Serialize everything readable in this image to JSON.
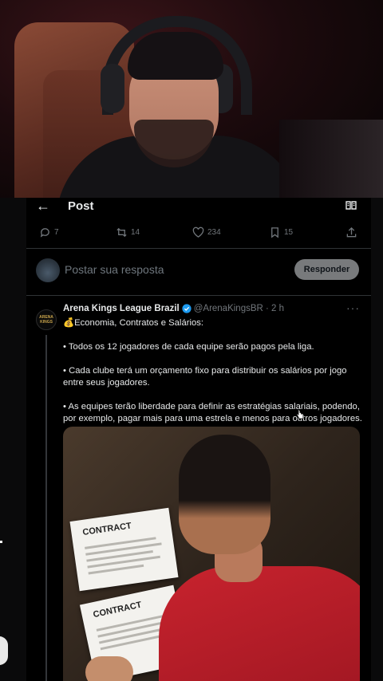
{
  "header": {
    "title": "Post",
    "back_icon": "arrow-left-icon",
    "reader_icon": "book-open-icon"
  },
  "actions": {
    "replies": "7",
    "reposts": "14",
    "likes": "234",
    "bookmarks": "15"
  },
  "reply_box": {
    "placeholder": "Postar sua resposta",
    "button_label": "Responder"
  },
  "tweet": {
    "author_name": "Arena Kings League Brazil",
    "handle_time": "@ArenaKingsBR · 2 h",
    "avatar_text": "ARENA KINGS",
    "lines": [
      "💰Economia, Contratos e Salários:",
      "• Todos os 12 jogadores de cada equipe serão pagos pela liga.",
      "• Cada clube terá um orçamento fixo para distribuir os salários por jogo entre seus jogadores.",
      "• As equipes terão liberdade para definir as estratégias salariais, podendo, por exemplo, pagar mais para uma estrela e menos para outros jogadores."
    ],
    "media": {
      "paper_1": "CONTRACT",
      "paper_2": "CONTRACT"
    }
  },
  "colors": {
    "background": "#000000",
    "muted": "#71767b",
    "verified": "#1d9bf0",
    "reply_button": "#787a7c"
  }
}
